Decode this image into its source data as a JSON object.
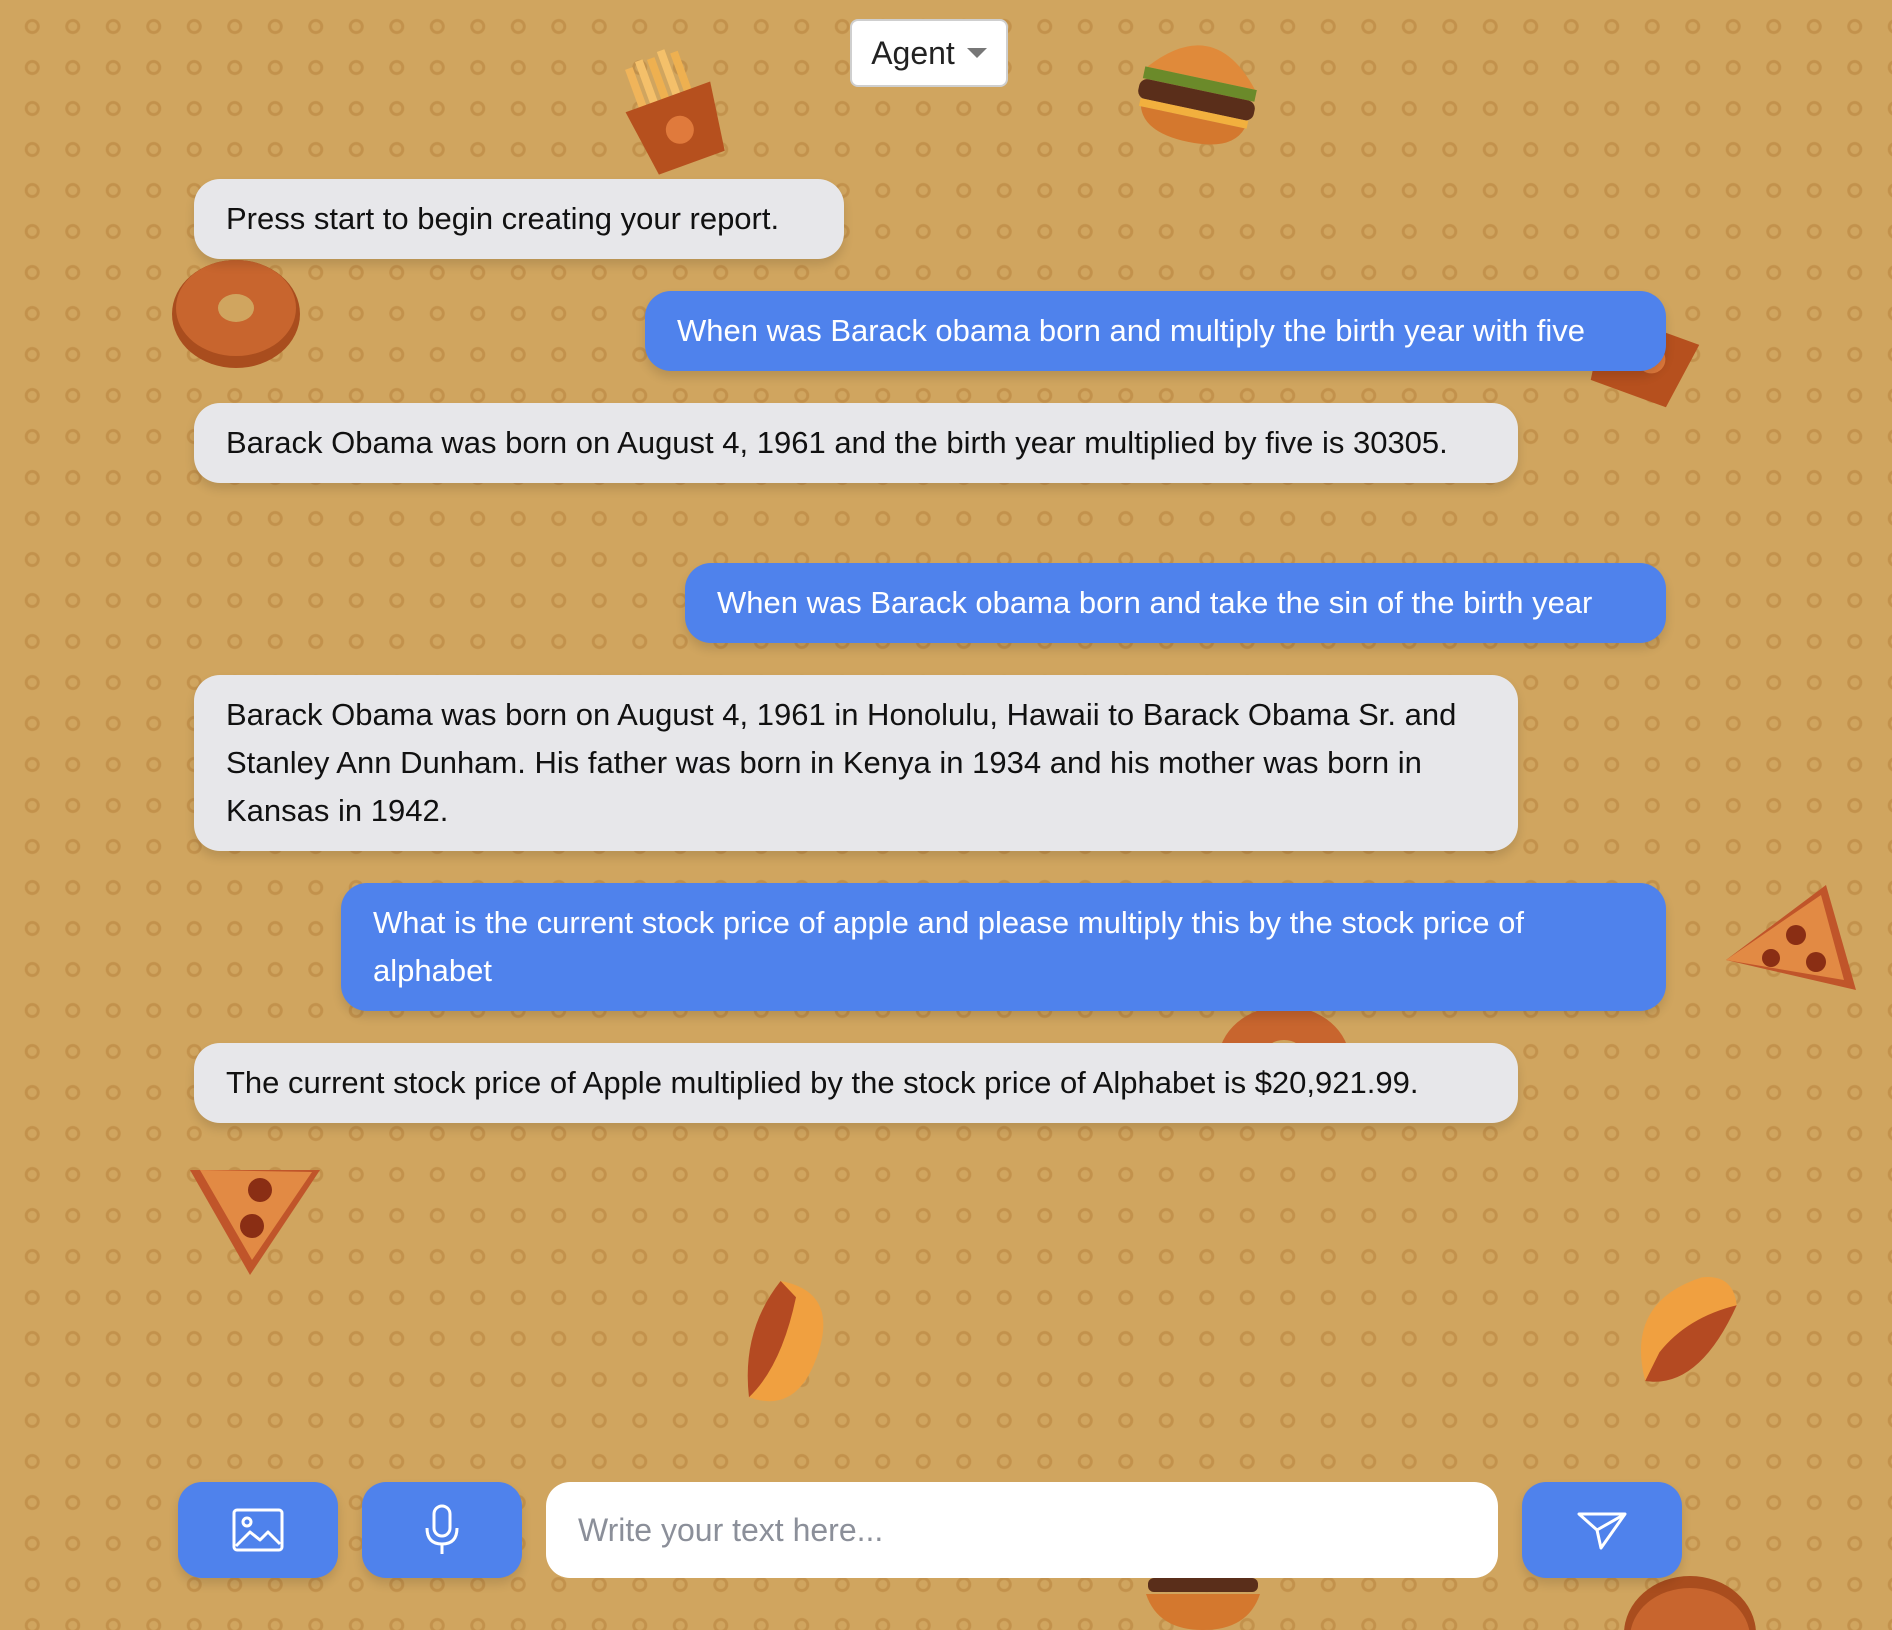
{
  "header": {
    "agent_selector": "Agent"
  },
  "messages": [
    {
      "role": "bot",
      "text": "Press start to begin creating your report."
    },
    {
      "role": "user",
      "text": "When was Barack obama born and multiply the birth year with five"
    },
    {
      "role": "bot",
      "text": "Barack Obama was born on August 4, 1961 and the birth year multiplied by five is 30305."
    },
    {
      "role": "user",
      "text": "When was Barack obama born and take the sin of the birth year"
    },
    {
      "role": "bot",
      "text": "Barack Obama was born on August 4, 1961 in Honolulu, Hawaii to Barack Obama Sr. and Stanley Ann Dunham. His father was born in Kenya in 1934 and his mother was born in Kansas in 1942."
    },
    {
      "role": "user",
      "text": "What is the current stock price of apple and please multiply this by the stock price of alphabet"
    },
    {
      "role": "bot",
      "text": "The current stock price of Apple multiplied by the stock price of Alphabet is $20,921.99."
    }
  ],
  "composer": {
    "placeholder": "Write your text here...",
    "value": ""
  },
  "icons": {
    "image_button": "image-icon",
    "mic_button": "microphone-icon",
    "send_button": "paper-plane-icon"
  },
  "colors": {
    "background": "#d0a55f",
    "user_bubble": "#4f82ec",
    "bot_bubble": "#e7e7ea",
    "button": "#4f82ec"
  }
}
